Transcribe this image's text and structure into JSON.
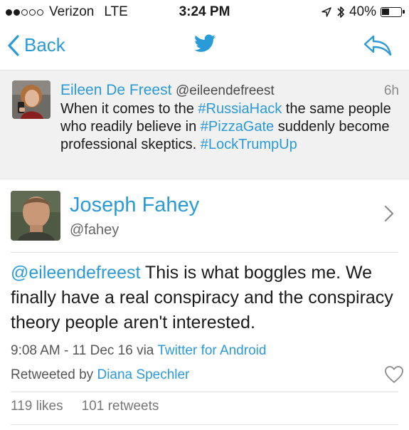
{
  "status_bar": {
    "signal_dots_filled": 2,
    "signal_dots_total": 5,
    "carrier": "Verizon",
    "network": "LTE",
    "time": "3:24 PM",
    "battery": "40%",
    "battery_level": 0.4,
    "icons": [
      "location-arrow-icon",
      "bluetooth-icon",
      "battery-icon"
    ]
  },
  "nav": {
    "back_label": "Back",
    "center_icon": "twitter-bird-icon",
    "right_icon": "reply-icon",
    "accent_color": "#2a9ad8"
  },
  "parent_tweet": {
    "name": "Eileen De Freest",
    "handle": "@eileendefreest",
    "age": "6h",
    "text": [
      {
        "t": "When it comes to the ",
        "link": false
      },
      {
        "t": "#RussiaHack",
        "link": true
      },
      {
        "t": " the same people who readily believe in ",
        "link": false
      },
      {
        "t": "#PizzaGate",
        "link": true
      },
      {
        "t": " suddenly become professional skeptics. ",
        "link": false
      },
      {
        "t": "#LockTrumpUp",
        "link": true
      }
    ]
  },
  "tweet": {
    "author_name": "Joseph Fahey",
    "author_handle": "@fahey",
    "mention": "@eileendefreest",
    "body": " This is what boggles me. We finally have a real conspiracy and the conspiracy theory people aren't interested.",
    "timestamp": "9:08 AM - 11 Dec 16 via ",
    "source": "Twitter for Android",
    "retweeted_by_label": "Retweeted by ",
    "retweeted_by_name": "Diana Spechler",
    "likes": "119 likes",
    "retweets": "101 retweets"
  }
}
